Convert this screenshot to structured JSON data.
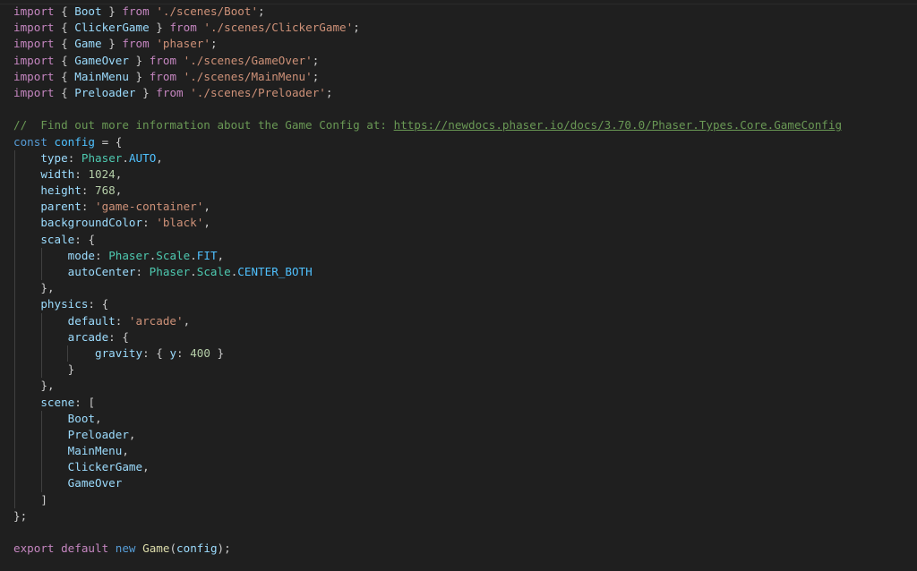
{
  "editor": {
    "language": "javascript",
    "colors": {
      "background": "#1f1f1f",
      "keyword": "#c586c0",
      "declaration": "#569cd6",
      "variable": "#9cdcfe",
      "constant": "#4fc1ff",
      "string": "#ce9178",
      "number": "#b5cea8",
      "class": "#4ec9b0",
      "function": "#dcdcaa",
      "comment": "#6a9955",
      "punctuation": "#cccccc",
      "bracket_level_1": "#ffd700",
      "bracket_level_2": "#da70d6",
      "bracket_level_3": "#179fff"
    },
    "lines": [
      {
        "guides": 0,
        "tokens": [
          {
            "t": "import",
            "c": "kw"
          },
          {
            "t": " ",
            "c": "p"
          },
          {
            "t": "{",
            "c": "b1"
          },
          {
            "t": " Boot ",
            "c": "var"
          },
          {
            "t": "}",
            "c": "b1"
          },
          {
            "t": " ",
            "c": "p"
          },
          {
            "t": "from",
            "c": "kw"
          },
          {
            "t": " ",
            "c": "p"
          },
          {
            "t": "'./scenes/Boot'",
            "c": "str"
          },
          {
            "t": ";",
            "c": "p"
          }
        ]
      },
      {
        "guides": 0,
        "tokens": [
          {
            "t": "import",
            "c": "kw"
          },
          {
            "t": " ",
            "c": "p"
          },
          {
            "t": "{",
            "c": "b1"
          },
          {
            "t": " ClickerGame ",
            "c": "var"
          },
          {
            "t": "}",
            "c": "b1"
          },
          {
            "t": " ",
            "c": "p"
          },
          {
            "t": "from",
            "c": "kw"
          },
          {
            "t": " ",
            "c": "p"
          },
          {
            "t": "'./scenes/ClickerGame'",
            "c": "str"
          },
          {
            "t": ";",
            "c": "p"
          }
        ]
      },
      {
        "guides": 0,
        "tokens": [
          {
            "t": "import",
            "c": "kw"
          },
          {
            "t": " ",
            "c": "p"
          },
          {
            "t": "{",
            "c": "b1"
          },
          {
            "t": " Game ",
            "c": "var"
          },
          {
            "t": "}",
            "c": "b1"
          },
          {
            "t": " ",
            "c": "p"
          },
          {
            "t": "from",
            "c": "kw"
          },
          {
            "t": " ",
            "c": "p"
          },
          {
            "t": "'phaser'",
            "c": "str"
          },
          {
            "t": ";",
            "c": "p"
          }
        ]
      },
      {
        "guides": 0,
        "tokens": [
          {
            "t": "import",
            "c": "kw"
          },
          {
            "t": " ",
            "c": "p"
          },
          {
            "t": "{",
            "c": "b1"
          },
          {
            "t": " GameOver ",
            "c": "var"
          },
          {
            "t": "}",
            "c": "b1"
          },
          {
            "t": " ",
            "c": "p"
          },
          {
            "t": "from",
            "c": "kw"
          },
          {
            "t": " ",
            "c": "p"
          },
          {
            "t": "'./scenes/GameOver'",
            "c": "str"
          },
          {
            "t": ";",
            "c": "p"
          }
        ]
      },
      {
        "guides": 0,
        "tokens": [
          {
            "t": "import",
            "c": "kw"
          },
          {
            "t": " ",
            "c": "p"
          },
          {
            "t": "{",
            "c": "b1"
          },
          {
            "t": " MainMenu ",
            "c": "var"
          },
          {
            "t": "}",
            "c": "b1"
          },
          {
            "t": " ",
            "c": "p"
          },
          {
            "t": "from",
            "c": "kw"
          },
          {
            "t": " ",
            "c": "p"
          },
          {
            "t": "'./scenes/MainMenu'",
            "c": "str"
          },
          {
            "t": ";",
            "c": "p"
          }
        ]
      },
      {
        "guides": 0,
        "tokens": [
          {
            "t": "import",
            "c": "kw"
          },
          {
            "t": " ",
            "c": "p"
          },
          {
            "t": "{",
            "c": "b1"
          },
          {
            "t": " Preloader ",
            "c": "var"
          },
          {
            "t": "}",
            "c": "b1"
          },
          {
            "t": " ",
            "c": "p"
          },
          {
            "t": "from",
            "c": "kw"
          },
          {
            "t": " ",
            "c": "p"
          },
          {
            "t": "'./scenes/Preloader'",
            "c": "str"
          },
          {
            "t": ";",
            "c": "p"
          }
        ]
      },
      {
        "guides": 0,
        "tokens": []
      },
      {
        "guides": 0,
        "tokens": [
          {
            "t": "//  Find out more information about the Game Config at: ",
            "c": "cmt"
          },
          {
            "t": "https://newdocs.phaser.io/docs/3.70.0/Phaser.Types.Core.GameConfig",
            "c": "url"
          }
        ]
      },
      {
        "guides": 0,
        "tokens": [
          {
            "t": "const",
            "c": "decl"
          },
          {
            "t": " ",
            "c": "p"
          },
          {
            "t": "config",
            "c": "const"
          },
          {
            "t": " = ",
            "c": "p"
          },
          {
            "t": "{",
            "c": "b1"
          }
        ]
      },
      {
        "guides": 1,
        "tokens": [
          {
            "t": "    ",
            "c": "p"
          },
          {
            "t": "type",
            "c": "var"
          },
          {
            "t": ": ",
            "c": "p"
          },
          {
            "t": "Phaser",
            "c": "cls"
          },
          {
            "t": ".",
            "c": "p"
          },
          {
            "t": "AUTO",
            "c": "const"
          },
          {
            "t": ",",
            "c": "p"
          }
        ]
      },
      {
        "guides": 1,
        "tokens": [
          {
            "t": "    ",
            "c": "p"
          },
          {
            "t": "width",
            "c": "var"
          },
          {
            "t": ": ",
            "c": "p"
          },
          {
            "t": "1024",
            "c": "num"
          },
          {
            "t": ",",
            "c": "p"
          }
        ]
      },
      {
        "guides": 1,
        "tokens": [
          {
            "t": "    ",
            "c": "p"
          },
          {
            "t": "height",
            "c": "var"
          },
          {
            "t": ": ",
            "c": "p"
          },
          {
            "t": "768",
            "c": "num"
          },
          {
            "t": ",",
            "c": "p"
          }
        ]
      },
      {
        "guides": 1,
        "tokens": [
          {
            "t": "    ",
            "c": "p"
          },
          {
            "t": "parent",
            "c": "var"
          },
          {
            "t": ": ",
            "c": "p"
          },
          {
            "t": "'game-container'",
            "c": "str"
          },
          {
            "t": ",",
            "c": "p"
          }
        ]
      },
      {
        "guides": 1,
        "tokens": [
          {
            "t": "    ",
            "c": "p"
          },
          {
            "t": "backgroundColor",
            "c": "var"
          },
          {
            "t": ": ",
            "c": "p"
          },
          {
            "t": "'black'",
            "c": "str"
          },
          {
            "t": ",",
            "c": "p"
          }
        ]
      },
      {
        "guides": 1,
        "tokens": [
          {
            "t": "    ",
            "c": "p"
          },
          {
            "t": "scale",
            "c": "var"
          },
          {
            "t": ": ",
            "c": "p"
          },
          {
            "t": "{",
            "c": "b2"
          }
        ]
      },
      {
        "guides": 2,
        "tokens": [
          {
            "t": "        ",
            "c": "p"
          },
          {
            "t": "mode",
            "c": "var"
          },
          {
            "t": ": ",
            "c": "p"
          },
          {
            "t": "Phaser",
            "c": "cls"
          },
          {
            "t": ".",
            "c": "p"
          },
          {
            "t": "Scale",
            "c": "cls"
          },
          {
            "t": ".",
            "c": "p"
          },
          {
            "t": "FIT",
            "c": "const"
          },
          {
            "t": ",",
            "c": "p"
          }
        ]
      },
      {
        "guides": 2,
        "tokens": [
          {
            "t": "        ",
            "c": "p"
          },
          {
            "t": "autoCenter",
            "c": "var"
          },
          {
            "t": ": ",
            "c": "p"
          },
          {
            "t": "Phaser",
            "c": "cls"
          },
          {
            "t": ".",
            "c": "p"
          },
          {
            "t": "Scale",
            "c": "cls"
          },
          {
            "t": ".",
            "c": "p"
          },
          {
            "t": "CENTER_BOTH",
            "c": "const"
          }
        ]
      },
      {
        "guides": 1,
        "tokens": [
          {
            "t": "    ",
            "c": "p"
          },
          {
            "t": "}",
            "c": "b2"
          },
          {
            "t": ",",
            "c": "p"
          }
        ]
      },
      {
        "guides": 1,
        "tokens": [
          {
            "t": "    ",
            "c": "p"
          },
          {
            "t": "physics",
            "c": "var"
          },
          {
            "t": ": ",
            "c": "p"
          },
          {
            "t": "{",
            "c": "b2"
          }
        ]
      },
      {
        "guides": 2,
        "tokens": [
          {
            "t": "        ",
            "c": "p"
          },
          {
            "t": "default",
            "c": "var"
          },
          {
            "t": ": ",
            "c": "p"
          },
          {
            "t": "'arcade'",
            "c": "str"
          },
          {
            "t": ",",
            "c": "p"
          }
        ]
      },
      {
        "guides": 2,
        "tokens": [
          {
            "t": "        ",
            "c": "p"
          },
          {
            "t": "arcade",
            "c": "var"
          },
          {
            "t": ": ",
            "c": "p"
          },
          {
            "t": "{",
            "c": "b3"
          }
        ]
      },
      {
        "guides": 3,
        "tokens": [
          {
            "t": "            ",
            "c": "p"
          },
          {
            "t": "gravity",
            "c": "var"
          },
          {
            "t": ": ",
            "c": "p"
          },
          {
            "t": "{",
            "c": "b1"
          },
          {
            "t": " ",
            "c": "p"
          },
          {
            "t": "y",
            "c": "var"
          },
          {
            "t": ": ",
            "c": "p"
          },
          {
            "t": "400",
            "c": "num"
          },
          {
            "t": " ",
            "c": "p"
          },
          {
            "t": "}",
            "c": "b1"
          }
        ]
      },
      {
        "guides": 2,
        "tokens": [
          {
            "t": "        ",
            "c": "p"
          },
          {
            "t": "}",
            "c": "b3"
          }
        ]
      },
      {
        "guides": 1,
        "tokens": [
          {
            "t": "    ",
            "c": "p"
          },
          {
            "t": "}",
            "c": "b2"
          },
          {
            "t": ",",
            "c": "p"
          }
        ]
      },
      {
        "guides": 1,
        "tokens": [
          {
            "t": "    ",
            "c": "p"
          },
          {
            "t": "scene",
            "c": "var"
          },
          {
            "t": ": ",
            "c": "p"
          },
          {
            "t": "[",
            "c": "b2"
          }
        ]
      },
      {
        "guides": 2,
        "tokens": [
          {
            "t": "        ",
            "c": "p"
          },
          {
            "t": "Boot",
            "c": "var"
          },
          {
            "t": ",",
            "c": "p"
          }
        ]
      },
      {
        "guides": 2,
        "tokens": [
          {
            "t": "        ",
            "c": "p"
          },
          {
            "t": "Preloader",
            "c": "var"
          },
          {
            "t": ",",
            "c": "p"
          }
        ]
      },
      {
        "guides": 2,
        "tokens": [
          {
            "t": "        ",
            "c": "p"
          },
          {
            "t": "MainMenu",
            "c": "var"
          },
          {
            "t": ",",
            "c": "p"
          }
        ]
      },
      {
        "guides": 2,
        "tokens": [
          {
            "t": "        ",
            "c": "p"
          },
          {
            "t": "ClickerGame",
            "c": "var"
          },
          {
            "t": ",",
            "c": "p"
          }
        ]
      },
      {
        "guides": 2,
        "tokens": [
          {
            "t": "        ",
            "c": "p"
          },
          {
            "t": "GameOver",
            "c": "var"
          }
        ]
      },
      {
        "guides": 1,
        "tokens": [
          {
            "t": "    ",
            "c": "p"
          },
          {
            "t": "]",
            "c": "b2"
          }
        ]
      },
      {
        "guides": 0,
        "tokens": [
          {
            "t": "}",
            "c": "b1"
          },
          {
            "t": ";",
            "c": "p"
          }
        ]
      },
      {
        "guides": 0,
        "tokens": []
      },
      {
        "guides": 0,
        "tokens": [
          {
            "t": "export",
            "c": "kw"
          },
          {
            "t": " ",
            "c": "p"
          },
          {
            "t": "default",
            "c": "kw"
          },
          {
            "t": " ",
            "c": "p"
          },
          {
            "t": "new",
            "c": "decl"
          },
          {
            "t": " ",
            "c": "p"
          },
          {
            "t": "Game",
            "c": "fn"
          },
          {
            "t": "(",
            "c": "b1"
          },
          {
            "t": "config",
            "c": "var"
          },
          {
            "t": ")",
            "c": "b1"
          },
          {
            "t": ";",
            "c": "p"
          }
        ]
      }
    ]
  }
}
